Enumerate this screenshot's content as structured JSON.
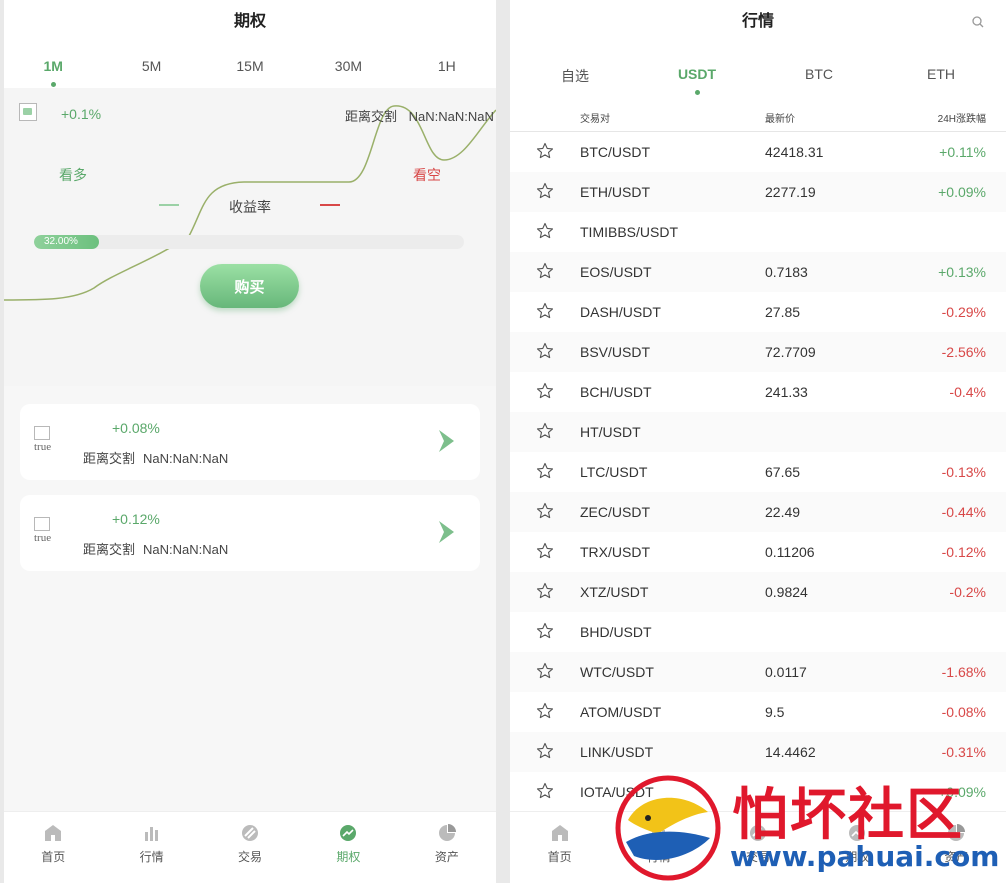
{
  "left": {
    "title": "期权",
    "timeframes": [
      "1M",
      "5M",
      "15M",
      "30M",
      "1H"
    ],
    "chart": {
      "change": "+0.1%",
      "distance_label": "距离交割",
      "countdown": "NaN:NaN:NaN",
      "long_label": "看多",
      "short_label": "看空",
      "yield_label": "收益率",
      "progress_text": "32.00%",
      "progress_value": 0.32,
      "buy_label": "购买"
    },
    "cards": [
      {
        "img_alt": "true",
        "change": "+0.08%",
        "distance_label": "距离交割",
        "countdown": "NaN:NaN:NaN"
      },
      {
        "img_alt": "true",
        "change": "+0.12%",
        "distance_label": "距离交割",
        "countdown": "NaN:NaN:NaN"
      }
    ]
  },
  "tabbar": [
    {
      "label": "首页",
      "icon": "home-icon"
    },
    {
      "label": "行情",
      "icon": "market-icon"
    },
    {
      "label": "交易",
      "icon": "trade-icon"
    },
    {
      "label": "期权",
      "icon": "options-icon"
    },
    {
      "label": "资产",
      "icon": "assets-icon"
    }
  ],
  "right": {
    "title": "行情",
    "tabs": [
      "自选",
      "USDT",
      "BTC",
      "ETH"
    ],
    "columns": {
      "pair": "交易对",
      "price": "最新价",
      "change": "24H涨跌幅"
    },
    "rows": [
      {
        "pair": "BTC/USDT",
        "price": "42418.31",
        "change": "+0.11%",
        "dir": "up"
      },
      {
        "pair": "ETH/USDT",
        "price": "2277.19",
        "change": "+0.09%",
        "dir": "up"
      },
      {
        "pair": "TIMIBBS/USDT",
        "price": "",
        "change": "",
        "dir": ""
      },
      {
        "pair": "EOS/USDT",
        "price": "0.7183",
        "change": "+0.13%",
        "dir": "up"
      },
      {
        "pair": "DASH/USDT",
        "price": "27.85",
        "change": "-0.29%",
        "dir": "down"
      },
      {
        "pair": "BSV/USDT",
        "price": "72.7709",
        "change": "-2.56%",
        "dir": "down"
      },
      {
        "pair": "BCH/USDT",
        "price": "241.33",
        "change": "-0.4%",
        "dir": "down"
      },
      {
        "pair": "HT/USDT",
        "price": "",
        "change": "",
        "dir": ""
      },
      {
        "pair": "LTC/USDT",
        "price": "67.65",
        "change": "-0.13%",
        "dir": "down"
      },
      {
        "pair": "ZEC/USDT",
        "price": "22.49",
        "change": "-0.44%",
        "dir": "down"
      },
      {
        "pair": "TRX/USDT",
        "price": "0.11206",
        "change": "-0.12%",
        "dir": "down"
      },
      {
        "pair": "XTZ/USDT",
        "price": "0.9824",
        "change": "-0.2%",
        "dir": "down"
      },
      {
        "pair": "BHD/USDT",
        "price": "",
        "change": "",
        "dir": ""
      },
      {
        "pair": "WTC/USDT",
        "price": "0.0117",
        "change": "-1.68%",
        "dir": "down"
      },
      {
        "pair": "ATOM/USDT",
        "price": "9.5",
        "change": "-0.08%",
        "dir": "down"
      },
      {
        "pair": "LINK/USDT",
        "price": "14.4462",
        "change": "-0.31%",
        "dir": "down"
      },
      {
        "pair": "IOTA/USDT",
        "price": "",
        "change": "+0.09%",
        "dir": "up"
      }
    ]
  },
  "watermark": {
    "title": "怕坏社区",
    "url": "www.pahuai.com"
  },
  "colors": {
    "accent": "#5aa86a",
    "up": "#5aa86a",
    "down": "#d84848"
  }
}
